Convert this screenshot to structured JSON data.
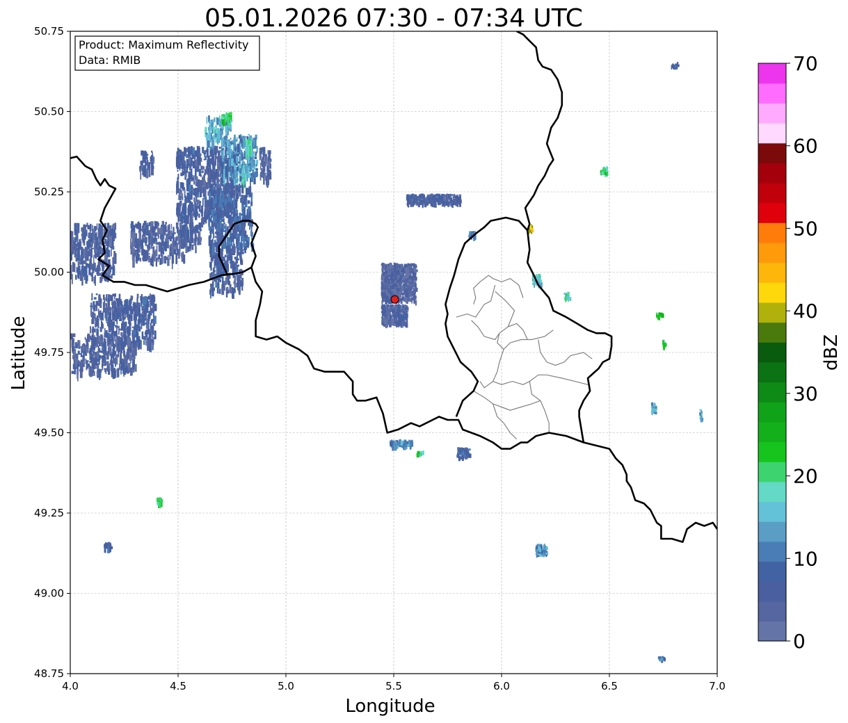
{
  "title": "05.01.2026 07:30 - 07:34 UTC",
  "info": {
    "line1": "Product: Maximum Reflectivity",
    "line2": "Data: RMIB"
  },
  "axes": {
    "xlabel": "Longitude",
    "ylabel": "Latitude",
    "xlim": [
      4.0,
      7.0
    ],
    "ylim": [
      48.75,
      50.75
    ],
    "xticks": [
      {
        "value": 4.0,
        "label": "4.0"
      },
      {
        "value": 4.5,
        "label": "4.5"
      },
      {
        "value": 5.0,
        "label": "5.0"
      },
      {
        "value": 5.5,
        "label": "5.5"
      },
      {
        "value": 6.0,
        "label": "6.0"
      },
      {
        "value": 6.5,
        "label": "6.5"
      },
      {
        "value": 7.0,
        "label": "7.0"
      }
    ],
    "yticks": [
      {
        "value": 48.75,
        "label": "48.75"
      },
      {
        "value": 49.0,
        "label": "49.00"
      },
      {
        "value": 49.25,
        "label": "49.25"
      },
      {
        "value": 49.5,
        "label": "49.50"
      },
      {
        "value": 49.75,
        "label": "49.75"
      },
      {
        "value": 50.0,
        "label": "50.00"
      },
      {
        "value": 50.25,
        "label": "50.25"
      },
      {
        "value": 50.5,
        "label": "50.50"
      },
      {
        "value": 50.75,
        "label": "50.75"
      }
    ],
    "grid": true
  },
  "radar_site": {
    "lon": 5.505,
    "lat": 49.915,
    "color": "#e0201c"
  },
  "colorbar": {
    "label": "dBZ",
    "min": 0,
    "max": 70,
    "ticks": [
      {
        "value": 0,
        "label": "0"
      },
      {
        "value": 10,
        "label": "10"
      },
      {
        "value": 20,
        "label": "20"
      },
      {
        "value": 30,
        "label": "30"
      },
      {
        "value": 40,
        "label": "40"
      },
      {
        "value": 50,
        "label": "50"
      },
      {
        "value": 60,
        "label": "60"
      },
      {
        "value": 70,
        "label": "70"
      }
    ],
    "colors": [
      "#6474a6",
      "#5566a0",
      "#4a5fa0",
      "#4263a3",
      "#4a7db5",
      "#5a9ec6",
      "#63c1d8",
      "#63d9c6",
      "#3dd46f",
      "#15c51d",
      "#13b01b",
      "#10a31a",
      "#0e8a16",
      "#0b7313",
      "#095c0e",
      "#4a7a0c",
      "#b0b20b",
      "#ffd80b",
      "#ffb60b",
      "#ff9a0b",
      "#ff7c0b",
      "#e0000b",
      "#c0000b",
      "#a4000b",
      "#7c0a0b",
      "#ffd9ff",
      "#ffaaff",
      "#ff6cff",
      "#ee35ee"
    ]
  },
  "borders": {
    "country": [
      [
        [
          4.0,
          50.355
        ],
        [
          4.03,
          50.36
        ],
        [
          4.07,
          50.33
        ],
        [
          4.1,
          50.32
        ],
        [
          4.12,
          50.29
        ],
        [
          4.14,
          50.27
        ],
        [
          4.16,
          50.29
        ],
        [
          4.18,
          50.27
        ],
        [
          4.21,
          50.26
        ],
        [
          4.16,
          50.2
        ],
        [
          4.14,
          50.16
        ],
        [
          4.17,
          50.13
        ],
        [
          4.15,
          50.1
        ],
        [
          4.16,
          50.06
        ],
        [
          4.13,
          50.04
        ],
        [
          4.18,
          50.02
        ],
        [
          4.15,
          49.99
        ],
        [
          4.2,
          49.97
        ],
        [
          4.25,
          49.97
        ],
        [
          4.3,
          49.96
        ],
        [
          4.35,
          49.96
        ],
        [
          4.4,
          49.95
        ],
        [
          4.45,
          49.94
        ],
        [
          4.5,
          49.95
        ],
        [
          4.55,
          49.96
        ],
        [
          4.62,
          49.97
        ],
        [
          4.7,
          49.99
        ],
        [
          4.76,
          49.995
        ],
        [
          4.8,
          50.0
        ],
        [
          4.84,
          50.015
        ],
        [
          4.86,
          50.05
        ],
        [
          4.84,
          50.09
        ],
        [
          4.87,
          50.14
        ],
        [
          4.86,
          50.15
        ],
        [
          4.83,
          50.16
        ],
        [
          4.8,
          50.16
        ],
        [
          4.76,
          50.15
        ],
        [
          4.73,
          50.12
        ],
        [
          4.71,
          50.1
        ],
        [
          4.69,
          50.08
        ],
        [
          4.69,
          50.05
        ],
        [
          4.71,
          50.02
        ],
        [
          4.73,
          49.99
        ]
      ],
      [
        [
          4.84,
          50.015
        ],
        [
          4.86,
          49.97
        ],
        [
          4.89,
          49.94
        ],
        [
          4.88,
          49.9
        ],
        [
          4.86,
          49.85
        ],
        [
          4.86,
          49.8
        ],
        [
          4.91,
          49.79
        ],
        [
          4.96,
          49.8
        ],
        [
          5.0,
          49.78
        ],
        [
          5.06,
          49.76
        ],
        [
          5.1,
          49.74
        ],
        [
          5.13,
          49.7
        ],
        [
          5.18,
          49.69
        ],
        [
          5.22,
          49.69
        ],
        [
          5.27,
          49.69
        ],
        [
          5.31,
          49.66
        ],
        [
          5.31,
          49.62
        ],
        [
          5.33,
          49.6
        ],
        [
          5.37,
          49.6
        ],
        [
          5.42,
          49.61
        ],
        [
          5.45,
          49.56
        ],
        [
          5.47,
          49.5
        ],
        [
          5.52,
          49.51
        ],
        [
          5.58,
          49.53
        ],
        [
          5.62,
          49.52
        ],
        [
          5.68,
          49.54
        ],
        [
          5.71,
          49.55
        ],
        [
          5.75,
          49.54
        ],
        [
          5.8,
          49.54
        ],
        [
          5.82,
          49.51
        ],
        [
          5.86,
          49.5
        ],
        [
          5.9,
          49.49
        ],
        [
          5.96,
          49.47
        ],
        [
          6.0,
          49.45
        ],
        [
          6.04,
          49.45
        ],
        [
          6.09,
          49.47
        ],
        [
          6.12,
          49.47
        ],
        [
          6.16,
          49.49
        ],
        [
          6.22,
          49.5
        ],
        [
          6.3,
          49.49
        ],
        [
          6.38,
          49.47
        ],
        [
          6.44,
          49.46
        ],
        [
          6.5,
          49.45
        ],
        [
          6.53,
          49.42
        ],
        [
          6.56,
          49.4
        ],
        [
          6.58,
          49.37
        ],
        [
          6.58,
          49.35
        ],
        [
          6.6,
          49.33
        ],
        [
          6.62,
          49.29
        ],
        [
          6.66,
          49.28
        ],
        [
          6.69,
          49.26
        ],
        [
          6.72,
          49.22
        ],
        [
          6.74,
          49.21
        ],
        [
          6.74,
          49.17
        ],
        [
          6.79,
          49.17
        ],
        [
          6.84,
          49.16
        ],
        [
          6.86,
          49.2
        ],
        [
          6.9,
          49.22
        ],
        [
          6.94,
          49.21
        ],
        [
          6.98,
          49.22
        ],
        [
          7.0,
          49.2
        ]
      ],
      [
        [
          5.79,
          49.55
        ],
        [
          5.82,
          49.6
        ],
        [
          5.87,
          49.63
        ],
        [
          5.89,
          49.66
        ],
        [
          5.86,
          49.69
        ],
        [
          5.81,
          49.72
        ],
        [
          5.75,
          49.8
        ],
        [
          5.74,
          49.84
        ],
        [
          5.75,
          49.87
        ],
        [
          5.74,
          49.9
        ],
        [
          5.76,
          49.95
        ],
        [
          5.78,
          49.99
        ],
        [
          5.8,
          50.04
        ],
        [
          5.83,
          50.09
        ],
        [
          5.88,
          50.12
        ],
        [
          5.92,
          50.14
        ],
        [
          5.95,
          50.16
        ],
        [
          6.02,
          50.17
        ],
        [
          6.08,
          50.16
        ],
        [
          6.12,
          50.13
        ],
        [
          6.13,
          50.07
        ],
        [
          6.12,
          50.03
        ],
        [
          6.15,
          49.99
        ],
        [
          6.17,
          49.96
        ],
        [
          6.22,
          49.92
        ],
        [
          6.24,
          49.88
        ],
        [
          6.3,
          49.86
        ],
        [
          6.35,
          49.84
        ],
        [
          6.4,
          49.82
        ],
        [
          6.44,
          49.81
        ],
        [
          6.48,
          49.81
        ],
        [
          6.51,
          49.8
        ],
        [
          6.51,
          49.77
        ],
        [
          6.5,
          49.73
        ],
        [
          6.47,
          49.72
        ],
        [
          6.45,
          49.7
        ],
        [
          6.4,
          49.67
        ],
        [
          6.41,
          49.63
        ],
        [
          6.38,
          49.6
        ],
        [
          6.36,
          49.57
        ],
        [
          6.36,
          49.55
        ],
        [
          6.38,
          49.47
        ]
      ],
      [
        [
          6.12,
          50.13
        ],
        [
          6.13,
          50.15
        ],
        [
          6.11,
          50.2
        ],
        [
          6.15,
          50.24
        ],
        [
          6.17,
          50.27
        ],
        [
          6.2,
          50.3
        ],
        [
          6.22,
          50.33
        ],
        [
          6.24,
          50.35
        ],
        [
          6.21,
          50.4
        ],
        [
          6.23,
          50.45
        ],
        [
          6.26,
          50.48
        ],
        [
          6.28,
          50.52
        ],
        [
          6.28,
          50.56
        ],
        [
          6.26,
          50.6
        ],
        [
          6.23,
          50.63
        ],
        [
          6.19,
          50.64
        ],
        [
          6.17,
          50.66
        ],
        [
          6.16,
          50.7
        ],
        [
          6.13,
          50.72
        ],
        [
          6.1,
          50.74
        ],
        [
          6.07,
          50.75
        ]
      ]
    ],
    "admin": [
      [
        [
          5.94,
          49.99
        ],
        [
          5.96,
          49.98
        ],
        [
          6.0,
          49.97
        ],
        [
          6.04,
          49.98
        ],
        [
          6.08,
          49.96
        ],
        [
          6.1,
          49.92
        ]
      ],
      [
        [
          5.97,
          49.96
        ],
        [
          5.95,
          49.91
        ],
        [
          5.92,
          49.9
        ],
        [
          5.9,
          49.88
        ],
        [
          5.88,
          49.86
        ],
        [
          5.84,
          49.87
        ],
        [
          5.79,
          49.86
        ]
      ],
      [
        [
          5.97,
          49.94
        ],
        [
          6.02,
          49.91
        ],
        [
          6.06,
          49.88
        ],
        [
          6.03,
          49.83
        ],
        [
          5.99,
          49.81
        ],
        [
          5.98,
          49.78
        ],
        [
          6.01,
          49.76
        ]
      ],
      [
        [
          6.01,
          49.76
        ],
        [
          6.04,
          49.78
        ],
        [
          6.09,
          49.79
        ],
        [
          6.14,
          49.79
        ],
        [
          6.2,
          49.8
        ],
        [
          6.24,
          49.82
        ]
      ],
      [
        [
          6.01,
          49.76
        ],
        [
          5.99,
          49.72
        ],
        [
          5.98,
          49.69
        ],
        [
          5.96,
          49.66
        ],
        [
          5.92,
          49.64
        ],
        [
          5.9,
          49.66
        ]
      ],
      [
        [
          6.17,
          49.79
        ],
        [
          6.18,
          49.75
        ],
        [
          6.21,
          49.72
        ],
        [
          6.25,
          49.71
        ],
        [
          6.29,
          49.72
        ],
        [
          6.32,
          49.74
        ],
        [
          6.38,
          49.75
        ],
        [
          6.42,
          49.73
        ]
      ],
      [
        [
          5.96,
          49.66
        ],
        [
          6.0,
          49.65
        ],
        [
          6.05,
          49.66
        ],
        [
          6.1,
          49.65
        ],
        [
          6.13,
          49.66
        ],
        [
          6.17,
          49.68
        ],
        [
          6.21,
          49.68
        ],
        [
          6.28,
          49.67
        ],
        [
          6.34,
          49.66
        ],
        [
          6.4,
          49.65
        ]
      ],
      [
        [
          6.13,
          49.66
        ],
        [
          6.14,
          49.62
        ],
        [
          6.18,
          49.6
        ],
        [
          6.2,
          49.57
        ],
        [
          6.22,
          49.53
        ],
        [
          6.22,
          49.5
        ]
      ],
      [
        [
          5.87,
          49.63
        ],
        [
          5.92,
          49.61
        ],
        [
          5.96,
          49.59
        ],
        [
          6.0,
          49.58
        ],
        [
          6.04,
          49.57
        ],
        [
          6.09,
          49.58
        ],
        [
          6.14,
          49.59
        ],
        [
          6.18,
          49.6
        ]
      ],
      [
        [
          5.96,
          49.59
        ],
        [
          5.98,
          49.55
        ],
        [
          6.01,
          49.53
        ],
        [
          6.04,
          49.5
        ],
        [
          6.07,
          49.48
        ]
      ],
      [
        [
          5.87,
          49.9
        ],
        [
          5.88,
          49.92
        ],
        [
          5.87,
          49.95
        ],
        [
          5.9,
          49.97
        ],
        [
          5.94,
          49.99
        ]
      ],
      [
        [
          5.86,
          49.85
        ],
        [
          5.89,
          49.83
        ],
        [
          5.92,
          49.8
        ],
        [
          5.97,
          49.79
        ],
        [
          5.99,
          49.81
        ]
      ],
      [
        [
          6.03,
          49.83
        ],
        [
          6.07,
          49.84
        ],
        [
          6.1,
          49.82
        ],
        [
          6.12,
          49.79
        ]
      ]
    ]
  },
  "echo_patches": [
    {
      "lon": 4.08,
      "lat": 50.07,
      "w": 0.25,
      "h": 0.17,
      "dbz": 5
    },
    {
      "lon": 4.24,
      "lat": 49.86,
      "w": 0.3,
      "h": 0.15,
      "dbz": 6
    },
    {
      "lon": 4.4,
      "lat": 50.1,
      "w": 0.25,
      "h": 0.12,
      "dbz": 4
    },
    {
      "lon": 4.15,
      "lat": 49.75,
      "w": 0.3,
      "h": 0.12,
      "dbz": 5
    },
    {
      "lon": 4.63,
      "lat": 50.28,
      "w": 0.28,
      "h": 0.23,
      "dbz": 6
    },
    {
      "lon": 4.74,
      "lat": 50.18,
      "w": 0.2,
      "h": 0.2,
      "dbz": 8
    },
    {
      "lon": 4.72,
      "lat": 50.02,
      "w": 0.15,
      "h": 0.15,
      "dbz": 6
    },
    {
      "lon": 4.78,
      "lat": 50.36,
      "w": 0.17,
      "h": 0.14,
      "dbz": 12
    },
    {
      "lon": 4.68,
      "lat": 50.45,
      "w": 0.12,
      "h": 0.08,
      "dbz": 14
    },
    {
      "lon": 4.72,
      "lat": 50.49,
      "w": 0.04,
      "h": 0.02,
      "dbz": 22
    },
    {
      "lon": 4.82,
      "lat": 50.4,
      "w": 0.03,
      "h": 0.03,
      "dbz": 20
    },
    {
      "lon": 4.8,
      "lat": 50.31,
      "w": 0.02,
      "h": 0.05,
      "dbz": 18
    },
    {
      "lon": 4.9,
      "lat": 50.34,
      "w": 0.05,
      "h": 0.1,
      "dbz": 4
    },
    {
      "lon": 4.35,
      "lat": 50.35,
      "w": 0.06,
      "h": 0.06,
      "dbz": 5
    },
    {
      "lon": 4.55,
      "lat": 50.12,
      "w": 0.1,
      "h": 0.08,
      "dbz": 5
    }
  ],
  "echo_speckles": [
    {
      "lon": 5.52,
      "lat": 49.97,
      "w": 0.16,
      "h": 0.12,
      "dbz": 4
    },
    {
      "lon": 5.5,
      "lat": 49.87,
      "w": 0.12,
      "h": 0.06,
      "dbz": 5
    },
    {
      "lon": 5.68,
      "lat": 50.23,
      "w": 0.25,
      "h": 0.03,
      "dbz": 6
    },
    {
      "lon": 6.13,
      "lat": 50.14,
      "w": 0.02,
      "h": 0.02,
      "dbz": 40
    },
    {
      "lon": 6.47,
      "lat": 50.32,
      "w": 0.03,
      "h": 0.02,
      "dbz": 20
    },
    {
      "lon": 6.73,
      "lat": 49.87,
      "w": 0.03,
      "h": 0.01,
      "dbz": 24
    },
    {
      "lon": 6.75,
      "lat": 49.78,
      "w": 0.01,
      "h": 0.02,
      "dbz": 20
    },
    {
      "lon": 6.16,
      "lat": 49.98,
      "w": 0.04,
      "h": 0.03,
      "dbz": 16
    },
    {
      "lon": 6.3,
      "lat": 49.93,
      "w": 0.03,
      "h": 0.02,
      "dbz": 18
    },
    {
      "lon": 5.86,
      "lat": 50.12,
      "w": 0.03,
      "h": 0.02,
      "dbz": 10
    },
    {
      "lon": 5.53,
      "lat": 49.47,
      "w": 0.1,
      "h": 0.02,
      "dbz": 12
    },
    {
      "lon": 5.62,
      "lat": 49.44,
      "w": 0.03,
      "h": 0.01,
      "dbz": 20
    },
    {
      "lon": 5.82,
      "lat": 49.44,
      "w": 0.06,
      "h": 0.03,
      "dbz": 8
    },
    {
      "lon": 4.41,
      "lat": 49.29,
      "w": 0.02,
      "h": 0.02,
      "dbz": 22
    },
    {
      "lon": 4.17,
      "lat": 49.15,
      "w": 0.03,
      "h": 0.02,
      "dbz": 8
    },
    {
      "lon": 6.18,
      "lat": 49.14,
      "w": 0.05,
      "h": 0.03,
      "dbz": 12
    },
    {
      "lon": 6.7,
      "lat": 49.58,
      "w": 0.02,
      "h": 0.03,
      "dbz": 14
    },
    {
      "lon": 6.92,
      "lat": 49.56,
      "w": 0.01,
      "h": 0.03,
      "dbz": 14
    },
    {
      "lon": 6.8,
      "lat": 50.65,
      "w": 0.03,
      "h": 0.01,
      "dbz": 8
    },
    {
      "lon": 6.74,
      "lat": 48.8,
      "w": 0.03,
      "h": 0.01,
      "dbz": 10
    }
  ]
}
